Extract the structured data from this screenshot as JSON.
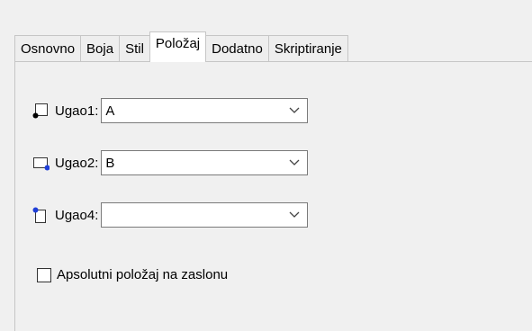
{
  "tabs": [
    "Osnovno",
    "Boja",
    "Stil",
    "Položaj",
    "Dodatno",
    "Skriptiranje"
  ],
  "active_tab": "Položaj",
  "corners": [
    {
      "label": "Ugao1:",
      "value": "A",
      "icon": "corner-bottom-left-icon"
    },
    {
      "label": "Ugao2:",
      "value": "B",
      "icon": "corner-bottom-right-icon"
    },
    {
      "label": "Ugao4:",
      "value": "",
      "icon": "corner-top-left-icon"
    }
  ],
  "absolute_position": {
    "label": "Apsolutni položaj na zaslonu",
    "checked": false
  },
  "colors": {
    "dot_black": "#000000",
    "dot_blue": "#1f3fd8"
  }
}
